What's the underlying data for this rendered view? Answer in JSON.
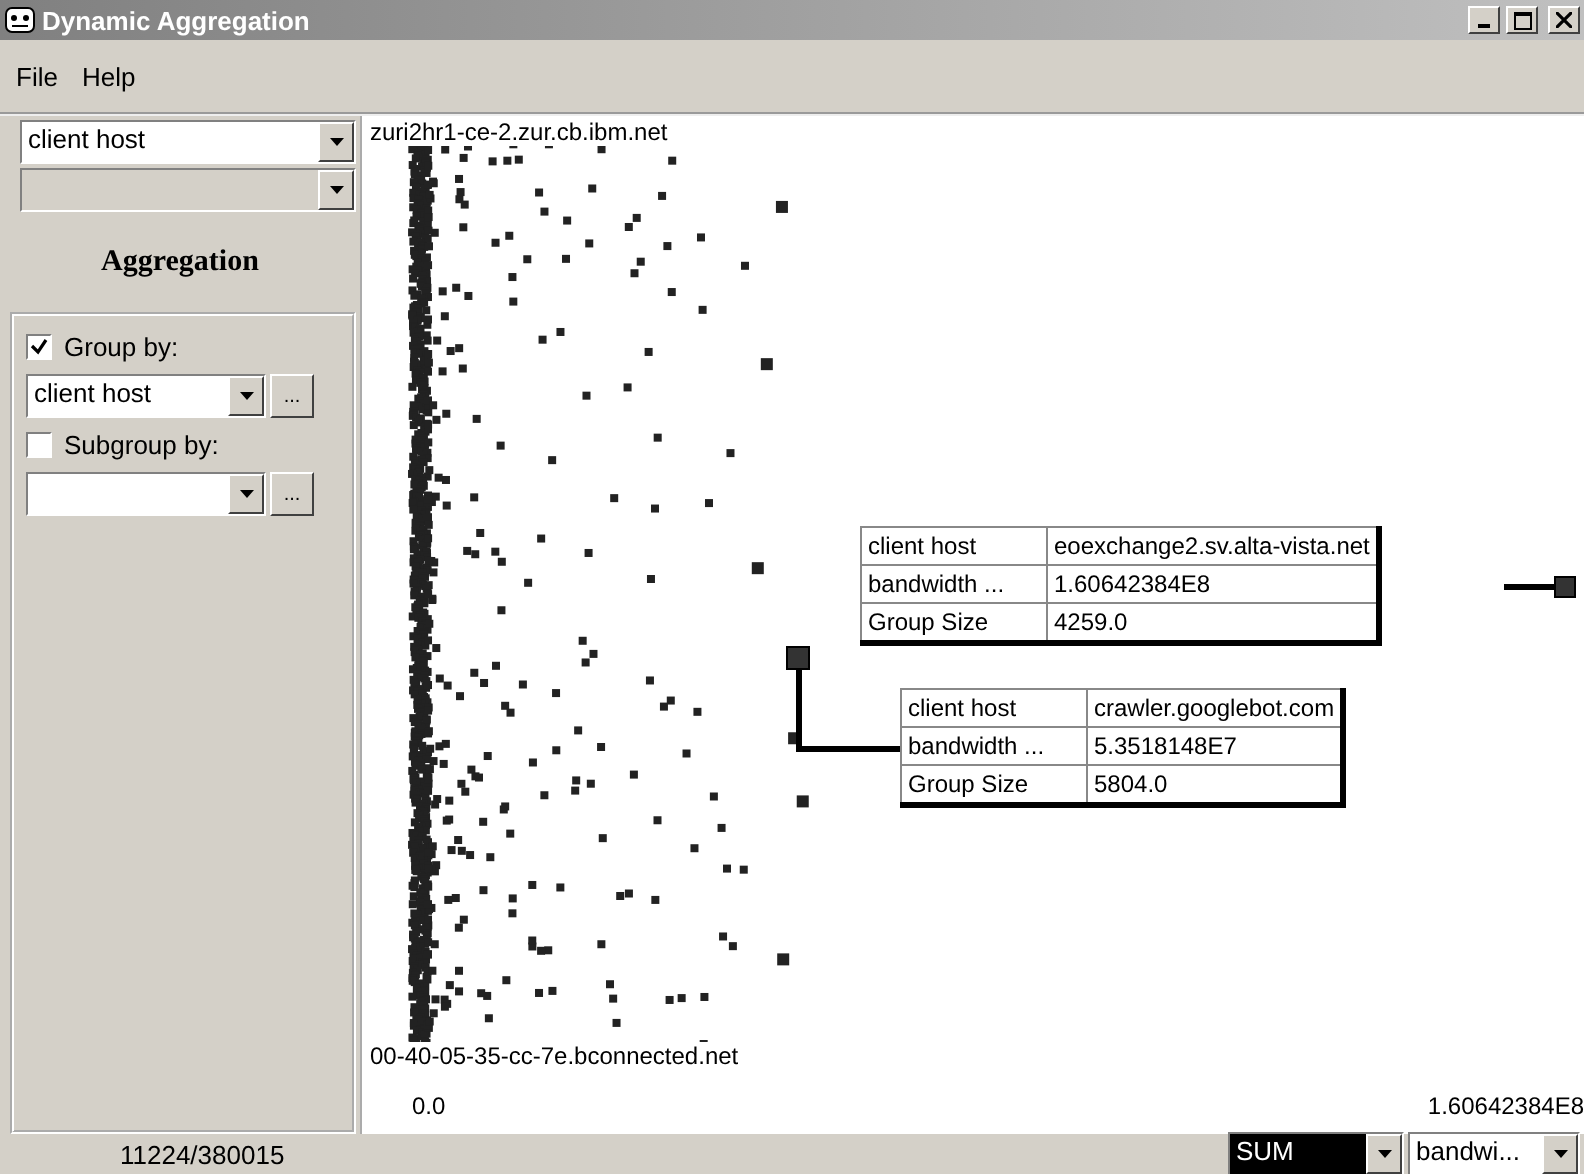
{
  "window": {
    "title": "Dynamic Aggregation"
  },
  "menu": [
    "File",
    "Help"
  ],
  "sidebar": {
    "field_select": {
      "value": "client host",
      "disabled": false
    },
    "second_select": {
      "disabled": true
    },
    "header": "Aggregation",
    "group_by": {
      "label": "Group by:",
      "checked": true,
      "value": "client host",
      "more": "..."
    },
    "subgroup_by": {
      "label": "Subgroup by:",
      "checked": false,
      "more": "..."
    }
  },
  "plot": {
    "top_label": "zuri2hr1-ce-2.zur.cb.ibm.net",
    "bottom_label": "00-40-05-35-cc-7e.bconnected.net",
    "x_min": "0.0",
    "x_max": "1.60642384E8",
    "tooltips": [
      {
        "rows": [
          {
            "key": "client host",
            "value": "eoexchange2.sv.alta-vista.net"
          },
          {
            "key": "bandwidth ...",
            "value": "1.60642384E8"
          },
          {
            "key": "Group Size",
            "value": "4259.0"
          }
        ]
      },
      {
        "rows": [
          {
            "key": "client host",
            "value": "crawler.googlebot.com"
          },
          {
            "key": "bandwidth ...",
            "value": "5.3518148E7"
          },
          {
            "key": "Group Size",
            "value": "5804.0"
          }
        ]
      }
    ]
  },
  "status_bar": {
    "count": "11224/380015",
    "function": {
      "value": "SUM",
      "highlighted": true
    },
    "measure": {
      "value": "bandwi...",
      "highlighted": false
    }
  }
}
